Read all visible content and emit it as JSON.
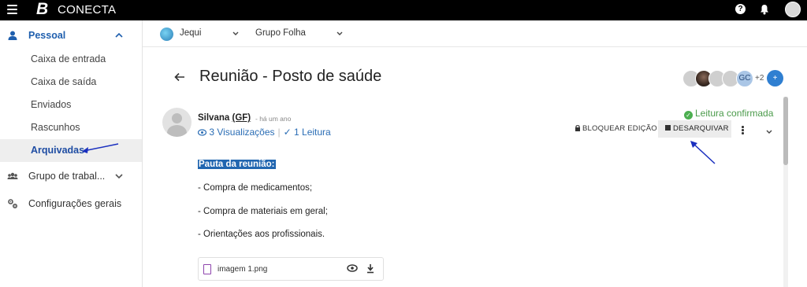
{
  "app": {
    "logo": "B",
    "brand": "CONECTA"
  },
  "sidebar": {
    "personal": {
      "label": "Pessoal",
      "icon": "person-icon"
    },
    "items": [
      {
        "label": "Caixa de entrada"
      },
      {
        "label": "Caixa de saída"
      },
      {
        "label": "Enviados"
      },
      {
        "label": "Rascunhos"
      },
      {
        "label": "Arquivadas",
        "active": true
      }
    ],
    "workgroup": {
      "label": "Grupo de trabal...",
      "icon": "group-icon"
    },
    "settings": {
      "label": "Configurações gerais",
      "icon": "settings-icon"
    }
  },
  "context": {
    "org": "Jequi",
    "group": "Grupo Folha"
  },
  "header": {
    "title": "Reunião - Posto de saúde",
    "participants_initials": "GC",
    "extra_count": "+2",
    "add_label": "+"
  },
  "message": {
    "author": "Silvana",
    "author_abbr": "(GF)",
    "time": "- há um ano",
    "views": "3 Visualizações",
    "reads": "✓ 1 Leitura",
    "read_status": "Leitura confirmada",
    "lock_label": "BLOQUEAR EDIÇÃO",
    "unarchive_label": "DESARQUIVAR",
    "body": {
      "heading": "Pauta da reunião:",
      "lines": [
        "- Compra de medicamentos;",
        "- Compra de materiais em geral;",
        "- Orientações aos profissionais."
      ]
    },
    "attachment": {
      "filename": "imagem 1.png"
    }
  },
  "colors": {
    "accent": "#2166b0",
    "active_link": "#1f4da3",
    "confirmed": "#4caf50",
    "annotation": "#1a2fbf"
  }
}
